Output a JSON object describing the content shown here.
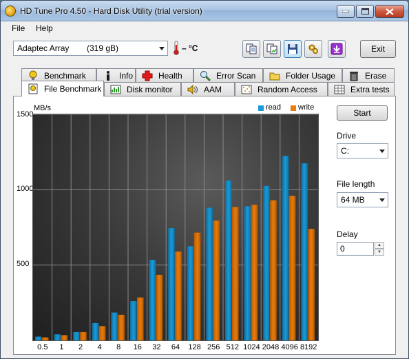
{
  "window": {
    "title": "HD Tune Pro 4.50 - Hard Disk Utility (trial version)"
  },
  "menu": {
    "file": "File",
    "help": "Help"
  },
  "toolbar": {
    "drive_select": "Adaptec Array",
    "drive_size": "(319 gB)",
    "temperature": "– °C",
    "exit_label": "Exit"
  },
  "tabs_top": [
    {
      "label": "Benchmark",
      "icon": "benchmark-icon"
    },
    {
      "label": "Info",
      "icon": "info-icon"
    },
    {
      "label": "Health",
      "icon": "health-cross-icon"
    },
    {
      "label": "Error Scan",
      "icon": "magnifier-icon"
    },
    {
      "label": "Folder Usage",
      "icon": "folder-icon"
    },
    {
      "label": "Erase",
      "icon": "trash-icon"
    }
  ],
  "tabs_bottom": [
    {
      "label": "File Benchmark",
      "icon": "file-benchmark-icon",
      "selected": true
    },
    {
      "label": "Disk monitor",
      "icon": "disk-monitor-icon"
    },
    {
      "label": "AAM",
      "icon": "speaker-icon"
    },
    {
      "label": "Random Access",
      "icon": "random-access-icon"
    },
    {
      "label": "Extra tests",
      "icon": "extra-tests-icon"
    }
  ],
  "side": {
    "start_label": "Start",
    "drive_label": "Drive",
    "drive_value": "C:",
    "file_length_label": "File length",
    "file_length_value": "64 MB",
    "delay_label": "Delay",
    "delay_value": "0"
  },
  "colors": {
    "read": "#1a9bd7",
    "write": "#e87c0c"
  },
  "chart_data": {
    "type": "bar",
    "ylabel": "MB/s",
    "y_tick_labels": [
      "1500",
      "1000",
      "500"
    ],
    "y_ticks": [
      1500,
      1000,
      500
    ],
    "ylim": [
      0,
      1500
    ],
    "grid": true,
    "legend_position": "top-right",
    "categories": [
      "0.5",
      "1",
      "2",
      "4",
      "8",
      "16",
      "32",
      "64",
      "128",
      "256",
      "512",
      "1024",
      "2048",
      "4096",
      "8192"
    ],
    "series": [
      {
        "name": "read",
        "values": [
          25,
          40,
          55,
          115,
          185,
          260,
          535,
          745,
          625,
          880,
          1060,
          890,
          1025,
          1225,
          1175
        ]
      },
      {
        "name": "write",
        "values": [
          20,
          35,
          55,
          95,
          170,
          285,
          435,
          590,
          715,
          795,
          885,
          900,
          930,
          960,
          740
        ]
      }
    ]
  }
}
